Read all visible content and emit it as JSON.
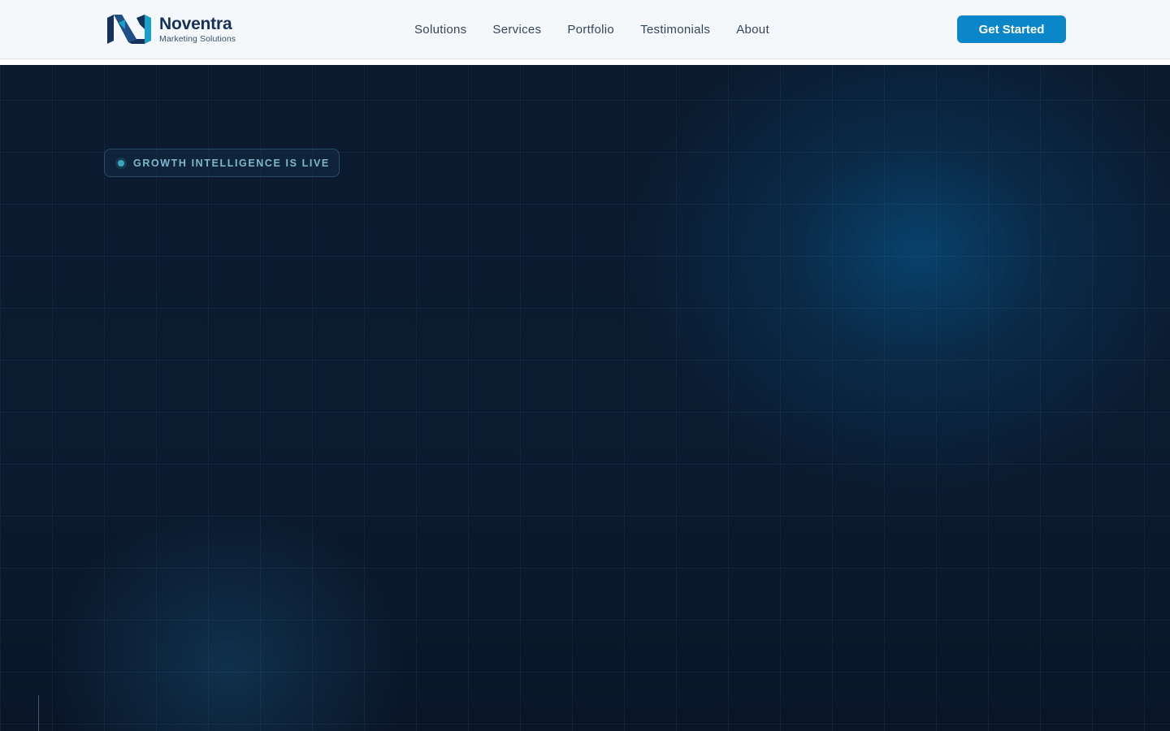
{
  "header": {
    "brand": {
      "name": "Noventra",
      "tagline": "Marketing Solutions",
      "logo_icon": "n-monogram-icon",
      "colors": {
        "dark": "#16325a",
        "accent": "#1aa0c8"
      }
    },
    "nav": [
      {
        "label": "Solutions"
      },
      {
        "label": "Services"
      },
      {
        "label": "Portfolio"
      },
      {
        "label": "Testimonials"
      },
      {
        "label": "About"
      }
    ],
    "cta_label": "Get Started",
    "cta_color": "#0b87c9"
  },
  "hero": {
    "status_badge": "GROWTH INTELLIGENCE IS LIVE",
    "badge_dot_color": "#3aa7bf",
    "background_color": "#0b1a2e"
  }
}
